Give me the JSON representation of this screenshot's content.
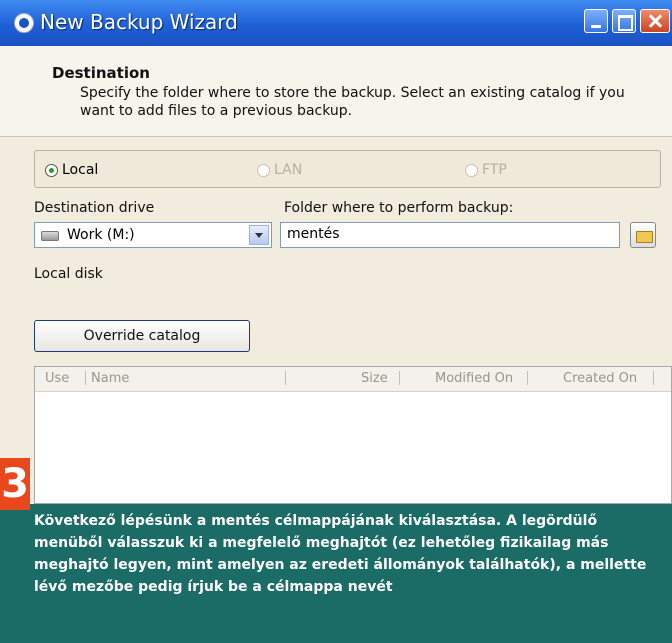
{
  "window": {
    "title": "New Backup Wizard",
    "controls": [
      "minimize-icon",
      "maximize-icon",
      "close-icon"
    ]
  },
  "header": {
    "title": "Destination",
    "description": "Specify the folder where to store the backup. Select an existing catalog if you want to add files to a previous backup."
  },
  "location": {
    "options": [
      {
        "label": "Local",
        "selected": true,
        "enabled": true
      },
      {
        "label": "LAN",
        "selected": false,
        "enabled": false
      },
      {
        "label": "FTP",
        "selected": false,
        "enabled": false
      }
    ]
  },
  "destination": {
    "drive_label": "Destination drive",
    "drive_value": "Work (M:)",
    "folder_label": "Folder where to perform backup:",
    "folder_value": "mentés",
    "drive_type": "Local disk"
  },
  "override_button": "Override catalog",
  "file_list": {
    "columns": [
      "Use",
      "Name",
      "Size",
      "Modified On",
      "Created On"
    ],
    "rows": []
  },
  "caption": {
    "step_number": "3",
    "text": "Következő lépésünk a mentés célmappájának kiválasztása. A legördülő menüből válasszuk ki a megfelelő meghajtót (ez lehetőleg fizikailag más meghajtó legyen, mint amelyen az eredeti állományok találhatók), a mellette lévő mezőbe pedig írjuk be a célmappa nevét"
  },
  "colors": {
    "titlebar": "#1f5fd6",
    "caption_bg": "#1b6b66",
    "step_badge": "#e8481c"
  }
}
